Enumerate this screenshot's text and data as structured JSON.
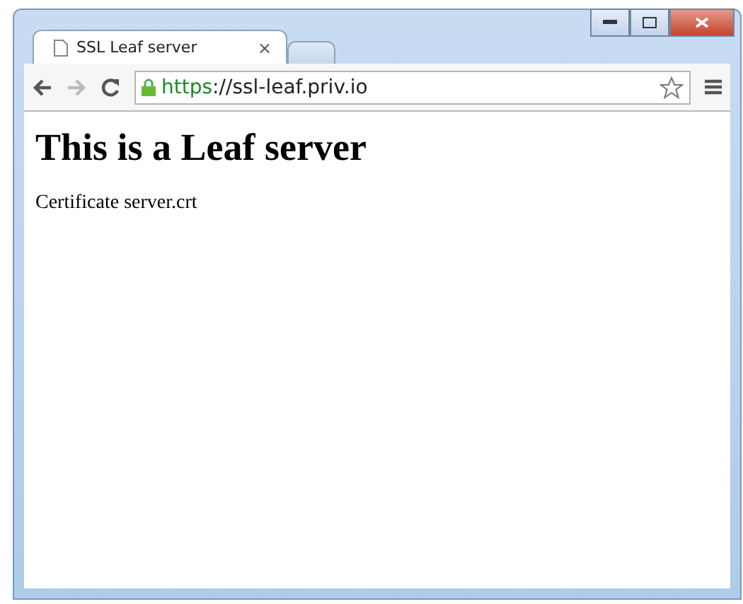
{
  "tabs": [
    {
      "title": "SSL Leaf server",
      "close": "×",
      "selected": true
    },
    {
      "selected": false
    }
  ],
  "address_bar": {
    "scheme": "https",
    "rest": "://ssl-leaf.priv.io"
  },
  "page": {
    "heading": "This is a Leaf server",
    "text": "Certificate server.crt"
  }
}
